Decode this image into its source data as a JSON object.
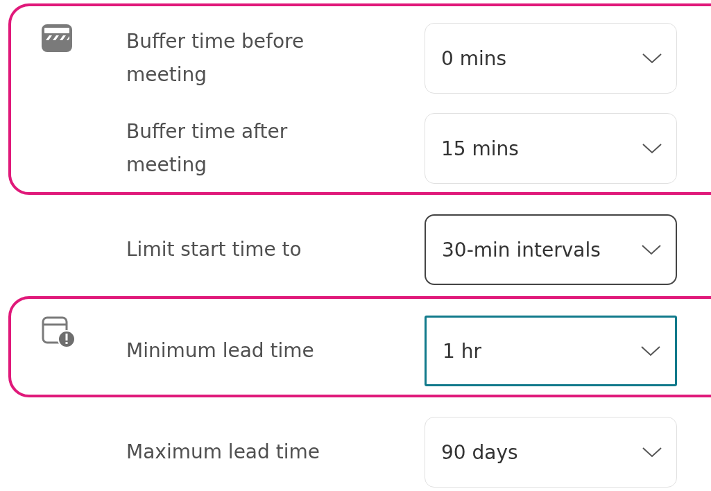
{
  "groups": [
    {
      "highlighted": true,
      "kind": "buffer",
      "rows": [
        {
          "label": "Buffer time before meeting",
          "value": "0 mins",
          "hovered": false,
          "focused": false
        },
        {
          "label": "Buffer time after meeting",
          "value": "15 mins",
          "hovered": false,
          "focused": false
        }
      ]
    },
    {
      "highlighted": false,
      "kind": "plain",
      "rows": [
        {
          "label": "Limit start time to",
          "value": "30-min intervals",
          "hovered": true,
          "focused": false
        }
      ]
    },
    {
      "highlighted": true,
      "kind": "lead",
      "rows": [
        {
          "label": "Minimum lead time",
          "value": "1 hr",
          "hovered": false,
          "focused": true
        }
      ]
    },
    {
      "highlighted": false,
      "kind": "plain",
      "rows": [
        {
          "label": "Maximum lead time",
          "value": "90 days",
          "hovered": false,
          "focused": false
        }
      ]
    }
  ]
}
